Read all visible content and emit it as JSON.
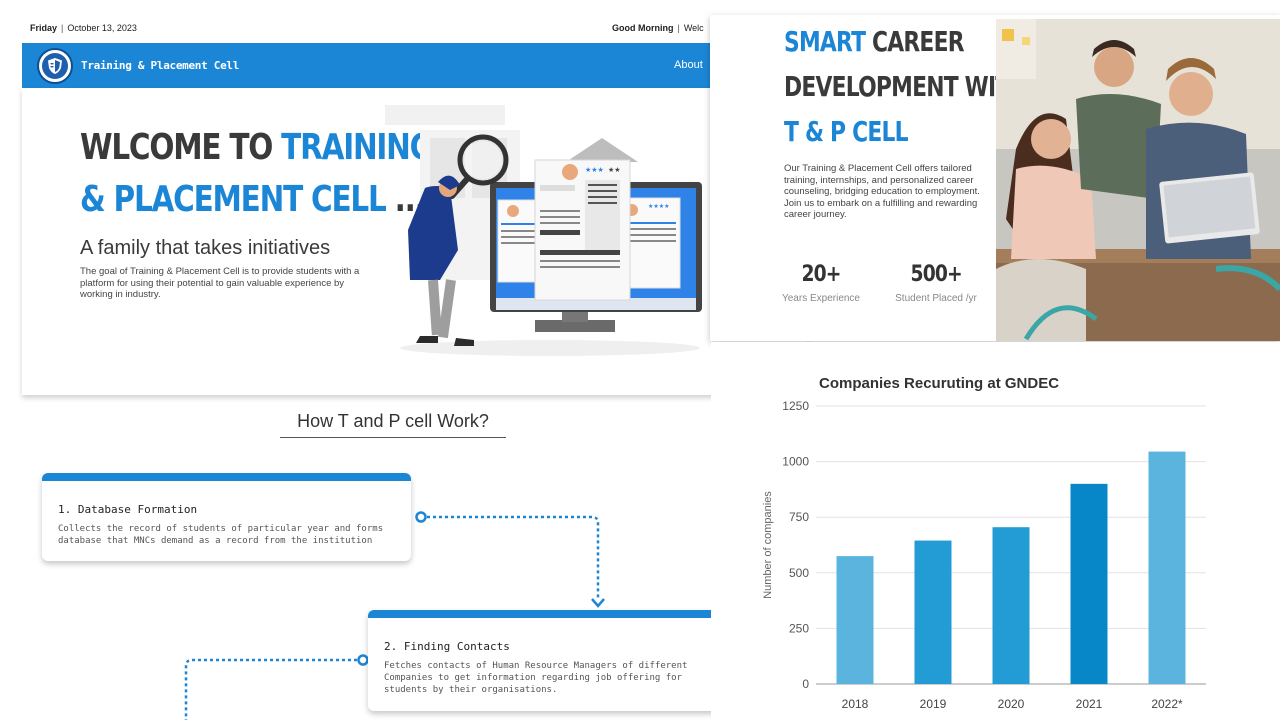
{
  "topbar": {
    "day": "Friday",
    "date": "October 13, 2023",
    "greeting": "Good Morning",
    "welcome": "Welc"
  },
  "navbar": {
    "brand": "Training & Placement Cell",
    "about": "About"
  },
  "hero": {
    "title_part1": "WLCOME TO ",
    "title_part2": "TRAINING",
    "title_part3": "& PLACEMENT CELL",
    "title_part4": " ...",
    "subtitle": "A family that takes initiatives",
    "description": "The goal of Training & Placement Cell is to provide students with a platform for using their potential to gain valuable experience by working in industry."
  },
  "how": {
    "title": "How T and P cell Work?",
    "steps": [
      {
        "title": "1. Database Formation",
        "desc": "Collects the record of students of particular year and forms database that MNCs demand as a record from the institution"
      },
      {
        "title": "2. Finding Contacts",
        "desc": "Fetches contacts of Human Resource Managers of different Companies to get information regarding job offering for students by their organisations."
      }
    ]
  },
  "career": {
    "h_smart": "SMART",
    "h_career": " CAREER",
    "h_line2": "DEVELOPMENT WITH",
    "h_line3": "T & P CELL",
    "description": "Our Training & Placement Cell offers tailored training, internships, and personalized career counseling, bridging education to employment. Join us to embark on a fulfilling and rewarding career journey.",
    "stats": [
      {
        "value": "20+",
        "label": "Years Experience"
      },
      {
        "value": "500+",
        "label": "Student Placed /yr"
      }
    ]
  },
  "colors": {
    "accent": "#1c86d6",
    "bar_light": "#5ab4dd",
    "bar_mid": "#239bd4",
    "bar_dark": "#0787c7"
  },
  "chart_data": {
    "type": "bar",
    "title": "Companies Recuruting at GNDEC",
    "ylabel": "Number of companies",
    "xlabel": "",
    "categories": [
      "2018",
      "2019",
      "2020",
      "2021",
      "2022*"
    ],
    "values": [
      575,
      645,
      705,
      900,
      1045
    ],
    "yticks": [
      0,
      250,
      500,
      750,
      1000,
      1250
    ],
    "ylim": [
      0,
      1250
    ],
    "grid": true
  }
}
